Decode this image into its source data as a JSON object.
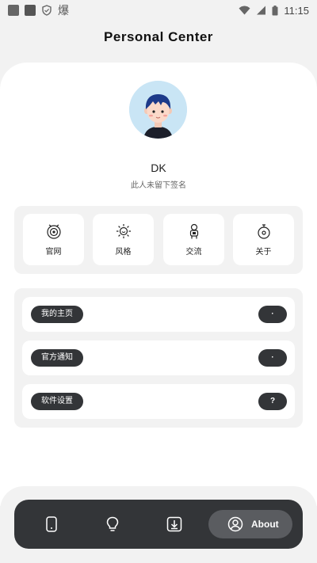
{
  "status_bar": {
    "time": "11:15",
    "notification_glyph": "爆"
  },
  "header": {
    "title": "Personal Center"
  },
  "profile": {
    "username": "DK",
    "signature": "此人未留下签名"
  },
  "quick_links": [
    {
      "label": "官网",
      "icon": "website-icon"
    },
    {
      "label": "风格",
      "icon": "style-icon"
    },
    {
      "label": "交流",
      "icon": "chat-icon"
    },
    {
      "label": "关于",
      "icon": "about-icon"
    }
  ],
  "menu": [
    {
      "label": "我的主页",
      "badge": "·"
    },
    {
      "label": "官方通知",
      "badge": "·"
    },
    {
      "label": "软件设置",
      "badge": "?"
    }
  ],
  "bottom_nav": {
    "items": [
      "phone-icon",
      "bulb-icon",
      "download-icon"
    ],
    "active_label": "About",
    "active_icon": "user-icon"
  },
  "colors": {
    "page_bg": "#f2f2f2",
    "dark": "#333538",
    "active_pill": "#5a5c60",
    "avatar_bg": "#c9e5f5"
  }
}
